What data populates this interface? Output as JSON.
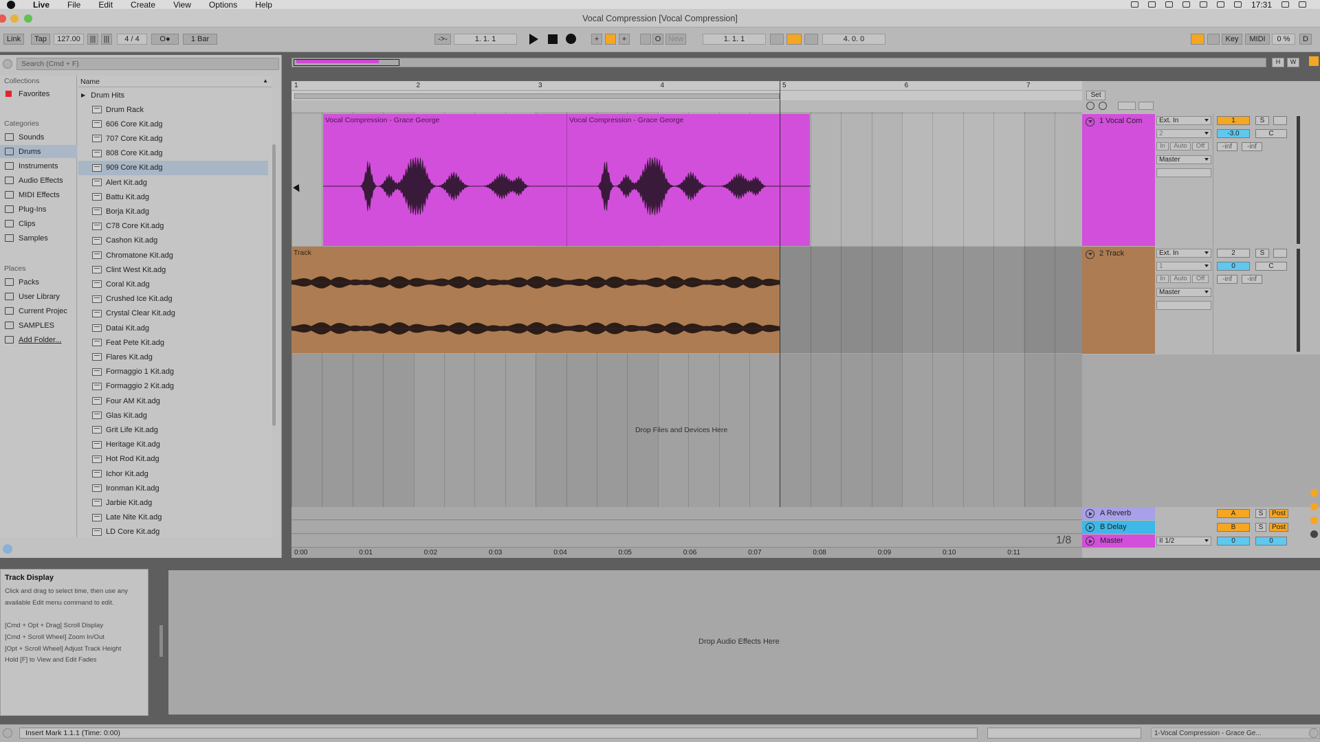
{
  "menubar": {
    "app": "Live",
    "items": [
      "File",
      "Edit",
      "Create",
      "View",
      "Options",
      "Help"
    ],
    "clock": "17:31"
  },
  "window": {
    "title": "Vocal Compression  [Vocal Compression]"
  },
  "transport": {
    "link": "Link",
    "tap": "Tap",
    "tempo": "127.00",
    "signature": "4 / 4",
    "metro": "O●",
    "quantize": "1 Bar",
    "position": "1.   1.   1",
    "punch_new": "New",
    "loop_start": "1.   1.   1",
    "loop_length": "4.   0.   0",
    "key": "Key",
    "midi": "MIDI",
    "cpu": "0 %",
    "disk": "D"
  },
  "browser": {
    "search_placeholder": "Search (Cmd + F)",
    "collections_label": "Collections",
    "favorites": "Favorites",
    "categories_label": "Categories",
    "categories": [
      "Sounds",
      "Drums",
      "Instruments",
      "Audio Effects",
      "MIDI Effects",
      "Plug-Ins",
      "Clips",
      "Samples"
    ],
    "places_label": "Places",
    "places": [
      "Packs",
      "User Library",
      "Current Projec",
      "SAMPLES",
      "Add Folder..."
    ],
    "column_header": "Name",
    "folder": "Drum Hits",
    "items": [
      "Drum Rack",
      "606 Core Kit.adg",
      "707 Core Kit.adg",
      "808 Core Kit.adg",
      "909 Core Kit.adg",
      "Alert Kit.adg",
      "Battu Kit.adg",
      "Borja Kit.adg",
      "C78 Core Kit.adg",
      "Cashon Kit.adg",
      "Chromatone Kit.adg",
      "Clint West Kit.adg",
      "Coral Kit.adg",
      "Crushed Ice Kit.adg",
      "Crystal Clear Kit.adg",
      "Datai Kit.adg",
      "Feat Pete Kit.adg",
      "Flares Kit.adg",
      "Formaggio 1 Kit.adg",
      "Formaggio 2 Kit.adg",
      "Four AM Kit.adg",
      "Glas Kit.adg",
      "Grit Life Kit.adg",
      "Heritage Kit.adg",
      "Hot Rod Kit.adg",
      "Ichor Kit.adg",
      "Ironman Kit.adg",
      "Jarbie Kit.adg",
      "Late Nite Kit.adg",
      "LD Core Kit.adg"
    ]
  },
  "arrangement": {
    "bars": [
      "1",
      "2",
      "3",
      "4",
      "5",
      "6",
      "7"
    ],
    "set_button": "Set",
    "clips": {
      "vocal_a": "Vocal Compression - Grace George",
      "vocal_b": "Vocal Compression - Grace George",
      "track": "Track"
    },
    "drop_text": "Drop Files and Devices Here",
    "zoom": "1/8",
    "time_labels": [
      "0:00",
      "0:01",
      "0:02",
      "0:03",
      "0:04",
      "0:05",
      "0:06",
      "0:07",
      "0:08",
      "0:09",
      "0:10",
      "0:11"
    ]
  },
  "tracks": [
    {
      "name": "1 Vocal Com",
      "input_type": "Ext. In",
      "input_channel": "2",
      "monitor": [
        "In",
        "Auto",
        "Off"
      ],
      "output": "Master",
      "number": "1",
      "volume": "-3.0",
      "pan": "C",
      "solo": "S",
      "peak_left": "-inf",
      "peak_right": "-inf",
      "color": "#d24fdb"
    },
    {
      "name": "2 Track",
      "input_type": "Ext. In",
      "input_channel": "1",
      "monitor": [
        "In",
        "Auto",
        "Off"
      ],
      "output": "Master",
      "number": "2",
      "volume": "0",
      "pan": "C",
      "solo": "S",
      "peak_left": "-inf",
      "peak_right": "-inf",
      "color": "#ad7c53"
    }
  ],
  "returns": [
    {
      "name": "A Reverb",
      "letter": "A",
      "solo": "S",
      "post": "Post",
      "color": "#a8a0e8"
    },
    {
      "name": "B Delay",
      "letter": "B",
      "solo": "S",
      "post": "Post",
      "color": "#3db8e8"
    }
  ],
  "master": {
    "name": "Master",
    "output": "II 1/2",
    "volume": "0",
    "pan": "0",
    "color": "#d24fdb"
  },
  "info": {
    "title": "Track Display",
    "body": "Click and drag to select time, then use any available Edit menu command to edit.\n\n[Cmd + Opt + Drag] Scroll Display\n[Cmd + Scroll Wheel] Zoom In/Out\n[Opt + Scroll Wheel] Adjust Track Height\nHold [F] to View and Edit Fades"
  },
  "device_drop": "Drop Audio Effects Here",
  "status": {
    "text": "Insert Mark 1.1.1 (Time: 0:00)",
    "right": "1-Vocal Compression - Grace Ge..."
  },
  "colors": {
    "accent_orange": "#f5a623",
    "accent_blue": "#5ec8ef",
    "selection": "#a8b6c6"
  }
}
